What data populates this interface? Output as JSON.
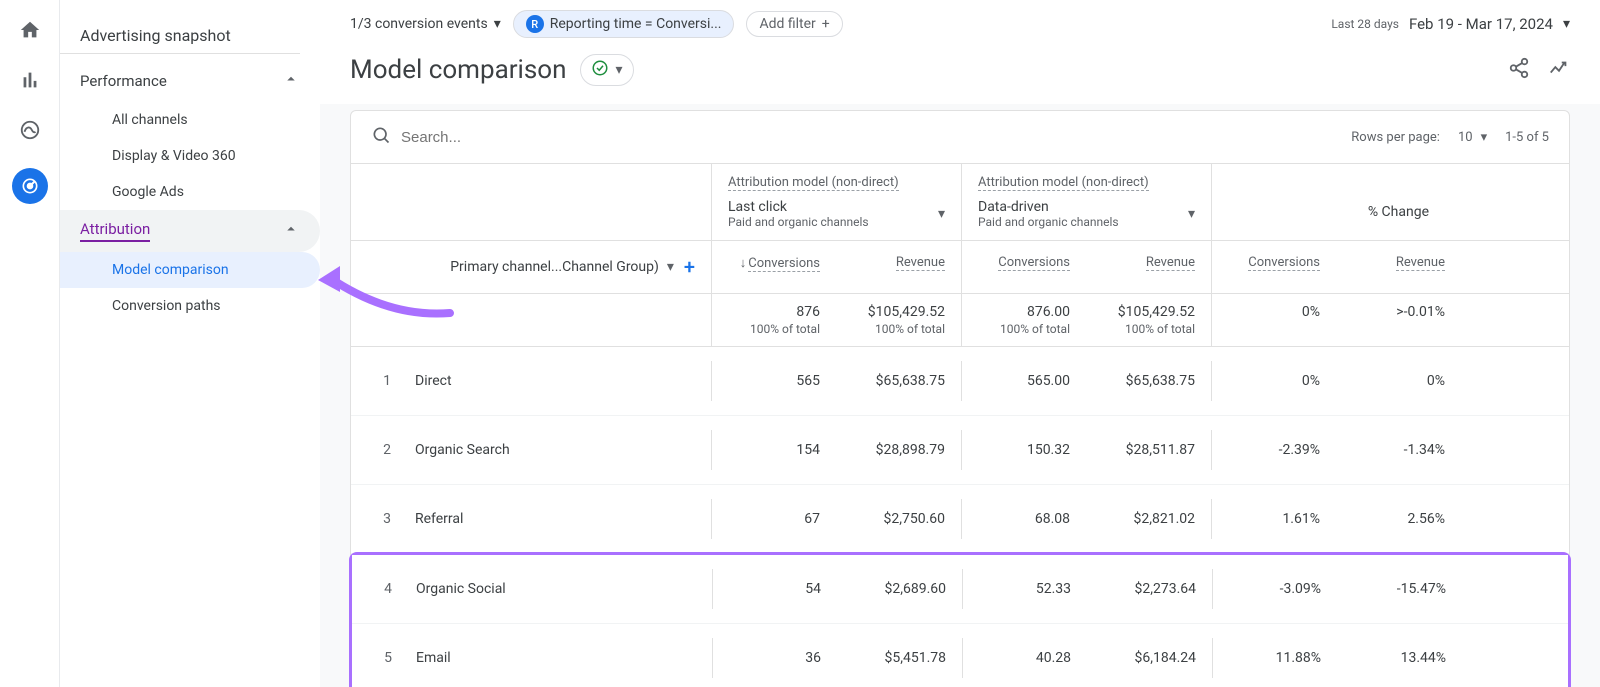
{
  "sidebar": {
    "heading": "Advertising snapshot",
    "sections": [
      {
        "label": "Performance",
        "items": [
          "All channels",
          "Display & Video 360",
          "Google Ads"
        ]
      },
      {
        "label": "Attribution",
        "items": [
          "Model comparison",
          "Conversion paths"
        ]
      }
    ]
  },
  "topbar": {
    "conv_events": "1/3 conversion events",
    "chip_badge": "R",
    "chip_text": "Reporting time = Conversi...",
    "add_filter": "Add filter",
    "date_prefix": "Last 28 days",
    "date_range": "Feb 19 - Mar 17, 2024"
  },
  "title": "Model comparison",
  "table": {
    "search_placeholder": "Search...",
    "rows_per_page_label": "Rows per page:",
    "rows_per_page_value": "10",
    "page_range": "1-5 of 5",
    "attr_header": "Attribution model (non-direct)",
    "model_a": {
      "name": "Last click",
      "sub": "Paid and organic channels"
    },
    "model_b": {
      "name": "Data-driven",
      "sub": "Paid and organic channels"
    },
    "change_label": "% Change",
    "primary_dim": "Primary channel...Channel Group)",
    "metrics": {
      "conversions": "Conversions",
      "revenue": "Revenue"
    },
    "summary": {
      "a_conv": "876",
      "a_conv_sub": "100% of total",
      "a_rev": "$105,429.52",
      "a_rev_sub": "100% of total",
      "b_conv": "876.00",
      "b_conv_sub": "100% of total",
      "b_rev": "$105,429.52",
      "b_rev_sub": "100% of total",
      "c_conv": "0%",
      "c_rev": ">-0.01%"
    },
    "rows": [
      {
        "n": "1",
        "label": "Direct",
        "a_conv": "565",
        "a_rev": "$65,638.75",
        "b_conv": "565.00",
        "b_rev": "$65,638.75",
        "c_conv": "0%",
        "c_rev": "0%"
      },
      {
        "n": "2",
        "label": "Organic Search",
        "a_conv": "154",
        "a_rev": "$28,898.79",
        "b_conv": "150.32",
        "b_rev": "$28,511.87",
        "c_conv": "-2.39%",
        "c_rev": "-1.34%"
      },
      {
        "n": "3",
        "label": "Referral",
        "a_conv": "67",
        "a_rev": "$2,750.60",
        "b_conv": "68.08",
        "b_rev": "$2,821.02",
        "c_conv": "1.61%",
        "c_rev": "2.56%"
      },
      {
        "n": "4",
        "label": "Organic Social",
        "a_conv": "54",
        "a_rev": "$2,689.60",
        "b_conv": "52.33",
        "b_rev": "$2,273.64",
        "c_conv": "-3.09%",
        "c_rev": "-15.47%"
      },
      {
        "n": "5",
        "label": "Email",
        "a_conv": "36",
        "a_rev": "$5,451.78",
        "b_conv": "40.28",
        "b_rev": "$6,184.24",
        "c_conv": "11.88%",
        "c_rev": "13.44%"
      }
    ]
  }
}
